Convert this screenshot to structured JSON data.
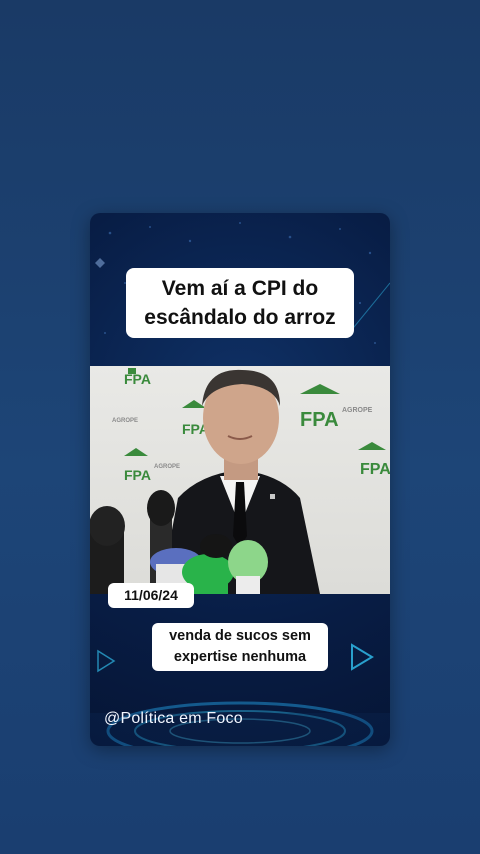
{
  "post": {
    "headline_line1": "Vem aí a CPI do",
    "headline_line2": "escândalo do arroz",
    "date": "11/06/24",
    "caption_line1": "venda de sucos sem",
    "caption_line2": "expertise nenhuma",
    "handle": "@Política em Foco"
  },
  "backdrop": {
    "logo_text": "FPA",
    "sub_text": "AGROPE"
  },
  "colors": {
    "page_bg": "#1d4577",
    "card_bg": "#081d45",
    "fpa_green": "#3a8a3c",
    "accent_cyan": "#2fb8e6"
  }
}
